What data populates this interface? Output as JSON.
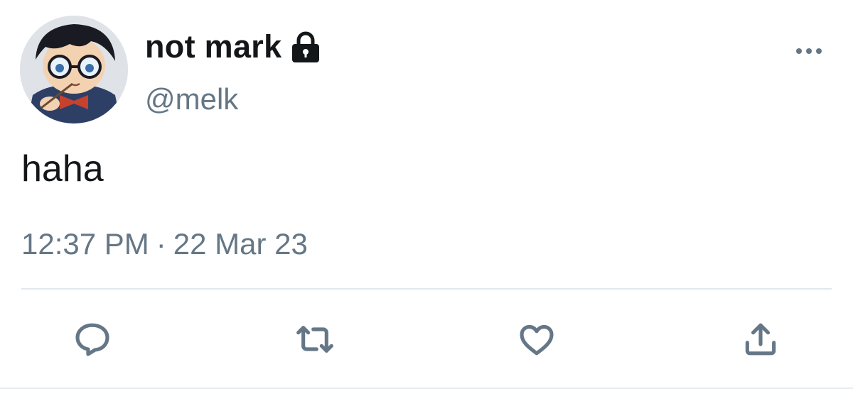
{
  "tweet": {
    "display_name": "not mark",
    "handle": "@melk",
    "text": "haha",
    "time": "12:37 PM",
    "separator": "·",
    "date": "22 Mar 23",
    "protected": true
  },
  "icons": {
    "lock": "lock-icon",
    "more": "more-options-icon",
    "reply": "reply-icon",
    "retweet": "retweet-icon",
    "like": "heart-icon",
    "share": "share-icon"
  },
  "colors": {
    "primary_text": "#14171a",
    "secondary_text": "#657786",
    "divider": "#e1e8ed"
  }
}
